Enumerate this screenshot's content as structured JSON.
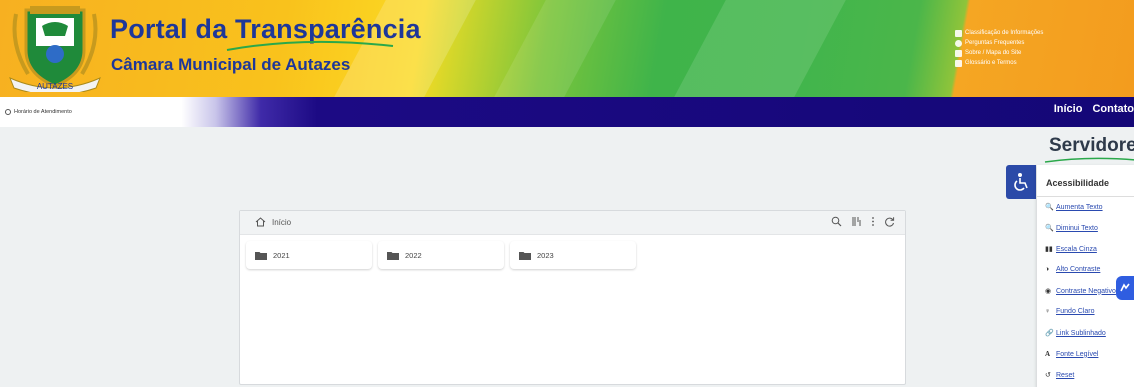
{
  "header": {
    "title": "Portal da Transparência",
    "subtitle": "Câmara Municipal de Autazes",
    "logo_text": "AUTAZES",
    "top_links": [
      {
        "label": "Classificação de Informações",
        "icon": "info-icon"
      },
      {
        "label": "Perguntas Frequentes",
        "icon": "question-icon"
      },
      {
        "label": "Sobre / Mapa do Site",
        "icon": "map-icon"
      },
      {
        "label": "Glossário e Termos",
        "icon": "book-icon"
      }
    ]
  },
  "navbar": {
    "hours": "Horário de Atendimento",
    "links": [
      "Início",
      "Contato"
    ]
  },
  "section": {
    "title": "Servidores"
  },
  "accessibility": {
    "title": "Acessibilidade",
    "items": [
      {
        "glyph": "🔍",
        "label": "Aumenta Texto"
      },
      {
        "glyph": "🔍",
        "label": "Diminui Texto"
      },
      {
        "glyph": "▮▮",
        "label": "Escala Cinza"
      },
      {
        "glyph": "◑",
        "label": "Alto Contraste"
      },
      {
        "glyph": "◉",
        "label": "Contraste Negativo"
      },
      {
        "glyph": "♀",
        "label": "Fundo Claro"
      },
      {
        "glyph": "🔗",
        "label": "Link Sublinhado"
      },
      {
        "glyph": "A",
        "label": "Fonte Legível"
      },
      {
        "glyph": "↺",
        "label": "Reset"
      }
    ]
  },
  "browser": {
    "breadcrumb": "Início",
    "folders": [
      "2021",
      "2022",
      "2023"
    ]
  },
  "colors": {
    "navbar": "#140777",
    "title": "#1e3799",
    "accessibility_button": "#2b4aa8"
  }
}
